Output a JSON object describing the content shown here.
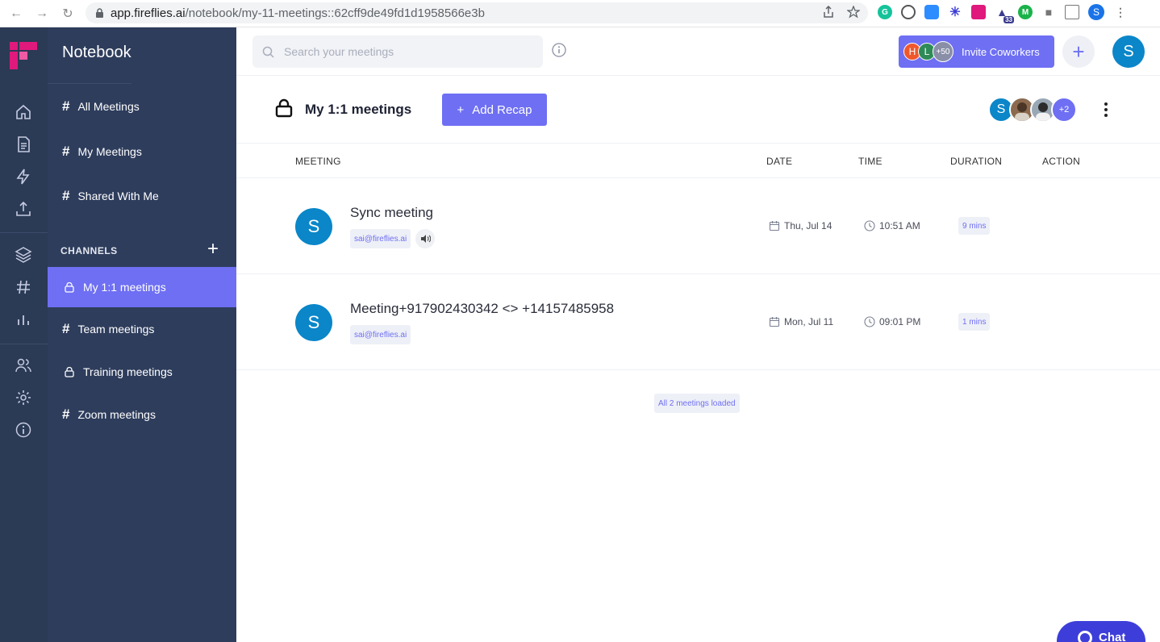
{
  "browser": {
    "url_host": "app.fireflies.ai",
    "url_path": "/notebook/my-11-meetings::62cff9de49fd1d1958566e3b",
    "extension_badge": "33",
    "profile_initial": "S"
  },
  "sidebar": {
    "title": "Notebook",
    "nav": [
      {
        "label": "All Meetings"
      },
      {
        "label": "My Meetings"
      },
      {
        "label": "Shared With Me"
      }
    ],
    "channels_label": "CHANNELS",
    "channels": [
      {
        "label": "My 1:1 meetings",
        "icon": "lock-icon",
        "active": true
      },
      {
        "label": "Team meetings",
        "icon": "hash-icon",
        "active": false
      },
      {
        "label": "Training meetings",
        "icon": "lock-icon",
        "active": false
      },
      {
        "label": "Zoom meetings",
        "icon": "hash-icon",
        "active": false
      }
    ]
  },
  "topbar": {
    "search_placeholder": "Search your meetings",
    "invite": {
      "avatars": [
        "H",
        "L",
        "+50"
      ],
      "label": "Invite Coworkers"
    },
    "user_initial": "S"
  },
  "header": {
    "title": "My 1:1 meetings",
    "add_recap_label": "Add Recap",
    "members_initial": "S",
    "members_more": "+2"
  },
  "table": {
    "columns": [
      "MEETING",
      "DATE",
      "TIME",
      "DURATION",
      "ACTION"
    ],
    "rows": [
      {
        "initial": "S",
        "title": "Sync meeting",
        "organizer": "sai@fireflies.ai",
        "has_audio": true,
        "date": "Thu, Jul 14",
        "time": "10:51 AM",
        "duration": "9 mins"
      },
      {
        "initial": "S",
        "title": "Meeting+917902430342 <> +14157485958",
        "organizer": "sai@fireflies.ai",
        "has_audio": false,
        "date": "Mon, Jul 11",
        "time": "09:01 PM",
        "duration": "1 mins"
      }
    ],
    "loaded_label": "All 2 meetings loaded"
  },
  "chat": {
    "label": "Chat"
  },
  "colors": {
    "accent": "#6e6ff3",
    "rail": "#2b3a55",
    "sidebar": "#2e3d5c",
    "avatar": "#0a86c9"
  }
}
